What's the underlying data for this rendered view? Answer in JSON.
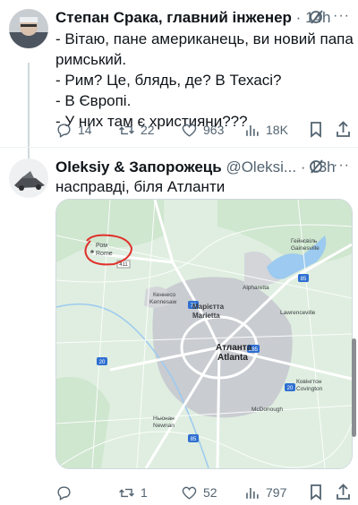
{
  "tweet1": {
    "name": "Степан Срака, главний інженер",
    "time": "14h",
    "lines": [
      "- Вітаю, пане американець, ви новий папа",
      "римський.",
      "- Рим? Це, блядь, де? В Техасі?",
      "- В Європі.",
      "- У них там є християни???"
    ],
    "stats": {
      "replies": "14",
      "retweets": "22",
      "likes": "963",
      "views": "18K"
    }
  },
  "tweet2": {
    "name": "Oleksiy & Запорожець",
    "handle": "@Oleksi...",
    "time": "13h",
    "text": "насправді, біля Атланти",
    "stats": {
      "replies": "",
      "retweets": "1",
      "likes": "52",
      "views": "797"
    }
  },
  "map": {
    "labels": {
      "rome_ua": "Ром",
      "rome_en": "Rome",
      "gainesville_ua": "Гейнсвіль",
      "gainesville_en": "Gainesville",
      "alpharetta": "Alpharetta",
      "kennesaw_ua": "Кеннесо",
      "kennesaw_en": "Kennesaw",
      "marietta_ua": "Марієтта",
      "marietta_en": "Marietta",
      "lawrenceville": "Lawrenceville",
      "atlanta_ua": "Атланта",
      "atlanta_en": "Atlanta",
      "covington_ua": "Ковінгтон",
      "covington_en": "Covington",
      "mcdonough": "McDonough",
      "newnan_ua": "Ньюнан",
      "newnan_en": "Newnan",
      "hwy_411": "411",
      "hwy_20": "20",
      "hwy_75": "75",
      "hwy_85": "85",
      "hwy_285": "285"
    },
    "colors": {
      "land": "#dfeee0",
      "urban": "#c9ccd1",
      "water": "#9ccaf0",
      "road": "#ffffff",
      "circle": "#e0312b"
    }
  },
  "colors": {
    "muted": "#536471",
    "text": "#0f1419",
    "line": "#cfd9de"
  }
}
